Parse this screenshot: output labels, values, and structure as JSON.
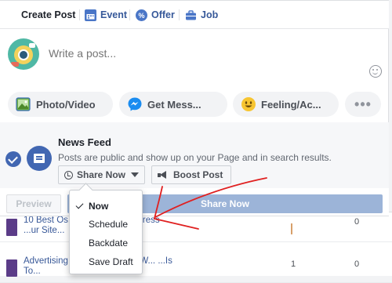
{
  "tabs": [
    {
      "label": "Create Post",
      "icon": "pencil-icon"
    },
    {
      "label": "Event",
      "icon": "calendar-icon"
    },
    {
      "label": "Offer",
      "icon": "offer-icon"
    },
    {
      "label": "Job",
      "icon": "briefcase-icon"
    }
  ],
  "composer": {
    "placeholder": "Write a post...",
    "avatar_icon": "page-avatar"
  },
  "actions": [
    {
      "label": "Photo/Video",
      "icon": "photo-icon"
    },
    {
      "label": "Get Mess...",
      "icon": "messenger-icon"
    },
    {
      "label": "Feeling/Ac...",
      "icon": "emoji-icon"
    },
    {
      "label": "",
      "icon": "more-icon"
    }
  ],
  "newsfeed": {
    "title": "News Feed",
    "description": "Posts are public and show up on your Page and in search results.",
    "share_now_label": "Share Now",
    "boost_label": "Boost Post"
  },
  "footer": {
    "preview_label": "Preview",
    "share_label": "Share Now"
  },
  "menu": {
    "items": [
      {
        "label": "Now",
        "selected": true
      },
      {
        "label": "Schedule",
        "selected": false
      },
      {
        "label": "Backdate",
        "selected": false
      },
      {
        "label": "Save Draft",
        "selected": false
      }
    ]
  },
  "background_rows": [
    {
      "title": "10 Best Os... ...um Plu Wordpress ...ur Site...",
      "col1": "1",
      "col2": "0"
    },
    {
      "title": "Advertising ...oogle Adsense W... ...Is To...",
      "col1": "1",
      "col2": "0"
    }
  ],
  "colors": {
    "brand": "#4267b2",
    "link": "#365899",
    "annotation": "#e02020"
  }
}
